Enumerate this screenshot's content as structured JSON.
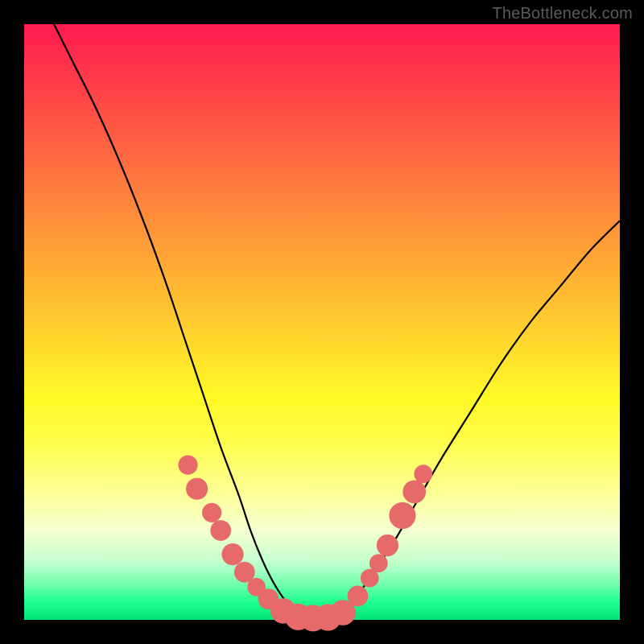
{
  "attribution": "TheBottleneck.com",
  "colors": {
    "frame": "#000000",
    "curve_stroke": "#000000",
    "marker_fill": "#e66a6a",
    "marker_stroke": "#d95a5a",
    "gradient_top": "#ff1a4f",
    "gradient_bottom": "#00e676"
  },
  "chart_data": {
    "type": "line",
    "title": "",
    "xlabel": "",
    "ylabel": "",
    "xlim": [
      0,
      100
    ],
    "ylim": [
      0,
      100
    ],
    "grid": false,
    "legend": false,
    "series": [
      {
        "name": "bottleneck-curve",
        "x": [
          5,
          8,
          12,
          16,
          20,
          24,
          27,
          30,
          33,
          36,
          38,
          40,
          42,
          44,
          46,
          48,
          50,
          52,
          55,
          58,
          62,
          66,
          70,
          75,
          80,
          85,
          90,
          95,
          100
        ],
        "y": [
          100,
          94,
          86,
          77,
          67,
          56,
          47,
          38,
          29,
          21,
          15,
          10,
          6,
          3,
          1,
          0,
          0,
          1,
          3,
          7,
          13,
          20,
          27,
          35,
          43,
          50,
          56,
          62,
          67
        ]
      }
    ],
    "markers": [
      {
        "name": "left-cluster-1",
        "x": 27.5,
        "y": 26,
        "r": 1.1
      },
      {
        "name": "left-cluster-2",
        "x": 29.0,
        "y": 22,
        "r": 1.3
      },
      {
        "name": "left-cluster-3",
        "x": 31.5,
        "y": 18,
        "r": 1.1
      },
      {
        "name": "left-cluster-4",
        "x": 33.0,
        "y": 15,
        "r": 1.2
      },
      {
        "name": "left-cluster-5",
        "x": 35.0,
        "y": 11,
        "r": 1.3
      },
      {
        "name": "left-cluster-6",
        "x": 37.0,
        "y": 8,
        "r": 1.2
      },
      {
        "name": "left-cluster-7",
        "x": 39.0,
        "y": 5.5,
        "r": 1.0
      },
      {
        "name": "left-cluster-8",
        "x": 41.0,
        "y": 3.5,
        "r": 1.2
      },
      {
        "name": "valley-1",
        "x": 43.5,
        "y": 1.5,
        "r": 1.6
      },
      {
        "name": "valley-2",
        "x": 46.0,
        "y": 0.5,
        "r": 1.7
      },
      {
        "name": "valley-3",
        "x": 48.5,
        "y": 0.3,
        "r": 1.7
      },
      {
        "name": "valley-4",
        "x": 51.0,
        "y": 0.4,
        "r": 1.7
      },
      {
        "name": "valley-5",
        "x": 53.5,
        "y": 1.2,
        "r": 1.6
      },
      {
        "name": "right-cluster-1",
        "x": 56.0,
        "y": 4.0,
        "r": 1.2
      },
      {
        "name": "right-cluster-2",
        "x": 58.0,
        "y": 7.0,
        "r": 1.0
      },
      {
        "name": "right-cluster-3",
        "x": 59.5,
        "y": 9.5,
        "r": 1.0
      },
      {
        "name": "right-cluster-4",
        "x": 61.0,
        "y": 12.5,
        "r": 1.3
      },
      {
        "name": "right-cluster-5",
        "x": 63.5,
        "y": 17.5,
        "r": 1.7
      },
      {
        "name": "right-cluster-6",
        "x": 65.5,
        "y": 21.5,
        "r": 1.4
      },
      {
        "name": "right-cluster-7",
        "x": 67.0,
        "y": 24.5,
        "r": 1.0
      }
    ]
  }
}
